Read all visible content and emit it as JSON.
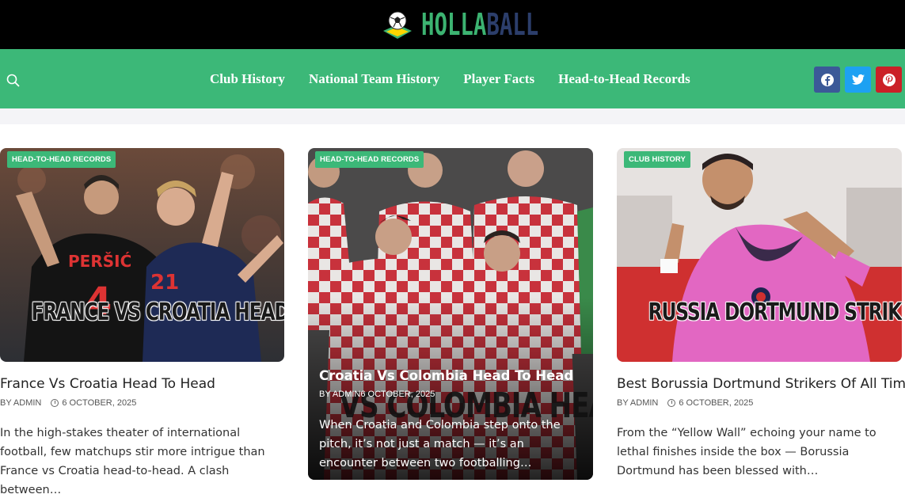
{
  "header": {
    "logo_text_1": "HOLLA",
    "logo_text_2": "BALL"
  },
  "nav": {
    "items": [
      {
        "label": "Club History"
      },
      {
        "label": "National Team History"
      },
      {
        "label": "Player Facts"
      },
      {
        "label": "Head-to-Head Records"
      }
    ],
    "search_icon": "search-icon",
    "social": [
      "facebook-icon",
      "twitter-icon",
      "pinterest-icon"
    ]
  },
  "colors": {
    "accent": "#3cb878",
    "topbar": "#000000",
    "facebook": "#3b5998",
    "twitter": "#1da1f2",
    "pinterest": "#cb2027"
  },
  "posts": [
    {
      "category": "HEAD-TO-HEAD RECORDS",
      "image_text": "FRANCE VS CROATIA HEAD TO HEAD",
      "title": "France Vs Croatia Head To Head",
      "author": "BY ADMIN",
      "date": "6 OCTOBER, 2025",
      "excerpt": "In the high-stakes theater of international football, few matchups stir more intrigue than France vs Croatia head-to-head. A clash between…"
    },
    {
      "category": "HEAD-TO-HEAD RECORDS",
      "image_text": "VS COLOMBIA HEAD",
      "title": "Croatia Vs Colombia Head To Head",
      "author": "BY ADMIN",
      "date": "6 OCTOBER, 2025",
      "excerpt": "When Croatia and Colombia step onto the pitch, it’s not just a match — it’s an encounter between two footballing…"
    },
    {
      "category": "CLUB HISTORY",
      "image_text": "RUSSIA DORTMUND STRIKERS OF A",
      "title": "Best Borussia Dortmund Strikers Of All Time",
      "author": "BY ADMIN",
      "date": "6 OCTOBER, 2025",
      "excerpt": "From the “Yellow Wall” echoing your name to lethal finishes inside the box — Borussia Dortmund has been blessed with…"
    }
  ]
}
